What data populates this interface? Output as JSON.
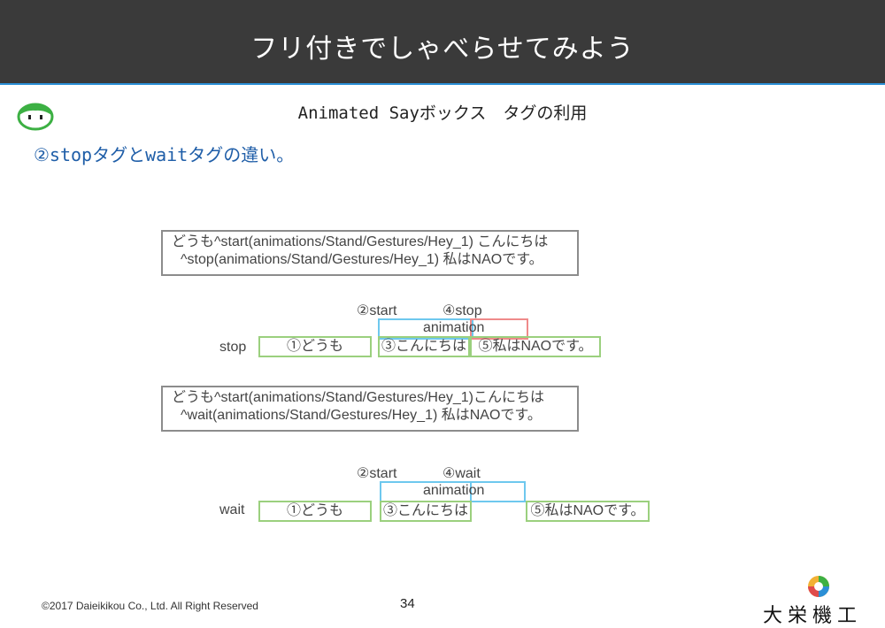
{
  "header": {
    "title": "フリ付きでしゃべらせてみよう"
  },
  "subtitle": "Animated Sayボックス　タグの利用",
  "heading": "②stopタグとwaitタグの違い。",
  "example_stop": {
    "code_line1": "どうも^start(animations/Stand/Gestures/Hey_1)  こんにちは",
    "code_line2": "^stop(animations/Stand/Gestures/Hey_1)  私はNAOです。",
    "start_label": "②start",
    "end_label": "④stop",
    "animation_label": "animation",
    "row_label": "stop",
    "seg1": "①どうも",
    "seg2": "③こんにちは",
    "seg3": "⑤私はNAOです。"
  },
  "example_wait": {
    "code_line1": "どうも^start(animations/Stand/Gestures/Hey_1)こんにちは",
    "code_line2": "^wait(animations/Stand/Gestures/Hey_1) 私はNAOです。",
    "start_label": "②start",
    "end_label": "④wait",
    "animation_label": "animation",
    "row_label": "wait",
    "seg1": "①どうも",
    "seg2": "③こんにちは",
    "seg3": "⑤私はNAOです。"
  },
  "footer": {
    "copyright": "©2017 Daieikikou Co., Ltd. All Right Reserved",
    "page_number": "34",
    "company_logo": "大栄機工"
  },
  "colors": {
    "header_bg": "#3a3a3a",
    "header_border": "#2b8fd6",
    "heading": "#1f5ea8",
    "green_box": "#9bd07e",
    "blue_box": "#6ec8ee",
    "red_box": "#ef8a8a"
  },
  "icons": {
    "mascot": "green-robot-face-icon",
    "logo": "company-logo-icon"
  }
}
